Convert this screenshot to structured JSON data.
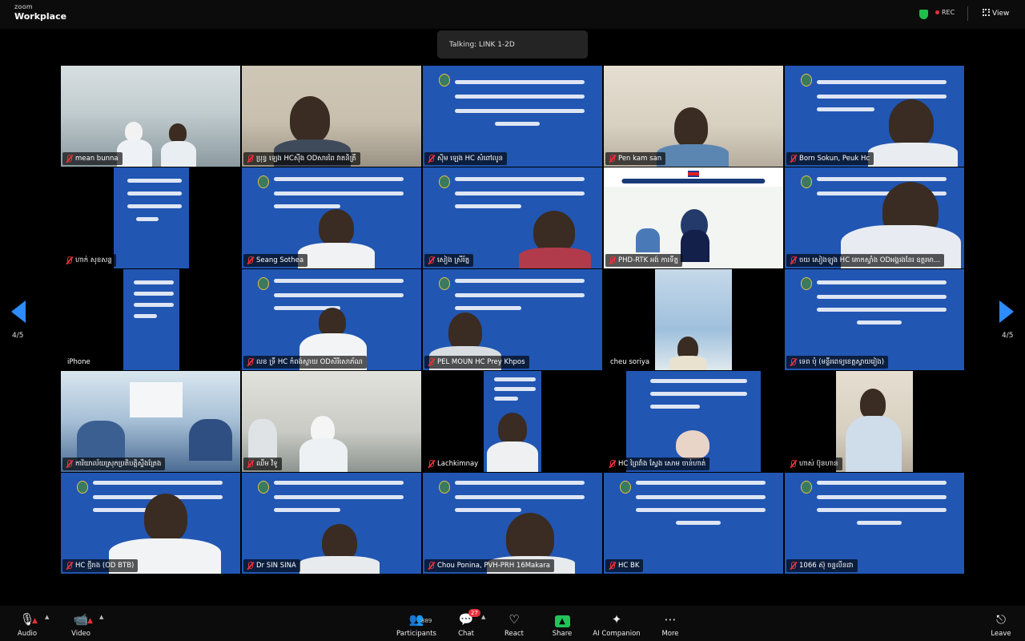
{
  "app": {
    "brand_top": "zoom",
    "brand_bottom": "Workplace"
  },
  "header": {
    "rec_label": "REC",
    "view_label": "View"
  },
  "talking": "Talking: LINK 1-2D",
  "pagination": {
    "left": "4/5",
    "right": "4/5"
  },
  "participants": [
    {
      "name": "mean bunna"
    },
    {
      "name": "ប្រុន្ធ ឡេង HCស៊ីង ODសារពៃ វាតនិត្រី"
    },
    {
      "name": "ស៊ិម ឡេង HC សំពៅលូន"
    },
    {
      "name": "Pen kam san"
    },
    {
      "name": "Born Sokun, Peuk Hc"
    },
    {
      "name": "ហាក់ សុខសន្ត"
    },
    {
      "name": "Seang Sothea"
    },
    {
      "name": "សៀង ស្រីរ័ត្ន"
    },
    {
      "name": "PHD-RTK អង់ ការទីត្ន"
    },
    {
      "name": "ចយ សៀងឡូង HC គោកស្វាំង ODអង្គរងនែរ ឧត្តរមា..."
    },
    {
      "name": "iPhone"
    },
    {
      "name": "លខ ទ្រី HC កំពង់ស្វាយ ODសិរីសោភ័ណ"
    },
    {
      "name": "PEL MOUN HC Prey Khpos"
    },
    {
      "name": "cheu soriya"
    },
    {
      "name": "ទេព បុំ (មន្ទីរពេទ្យខេត្តស្វាយរៀង)"
    },
    {
      "name": "ការិយាល័យស្រុកប្រតិបត្តិស្ទឹងត្រែង"
    },
    {
      "name": "ឈីម វិទូ"
    },
    {
      "name": "Lachkimnay"
    },
    {
      "name": "HC ព្រៃវាំង ស្វែង សោម ចាន់ហាត់"
    },
    {
      "name": "ហាស់ ប៊ុនហាន"
    },
    {
      "name": "HC ថ្មីរាង (OD BTB)"
    },
    {
      "name": "Dr SIN SINA"
    },
    {
      "name": "Chou Ponina, PVH-PRH 16Makara"
    },
    {
      "name": "HC BK"
    },
    {
      "name": "1066 ស៊ុ ចន្ទលីនដា"
    }
  ],
  "toolbar": {
    "audio": "Audio",
    "video": "Video",
    "participants": "Participants",
    "participants_count": "889",
    "chat": "Chat",
    "chat_badge": "27",
    "react": "React",
    "share": "Share",
    "ai": "AI Companion",
    "more": "More",
    "leave": "Leave"
  },
  "colors": {
    "accent": "#2d8cff",
    "muted": "#e8303a",
    "share": "#22c45a",
    "slide": "#2156b3"
  }
}
